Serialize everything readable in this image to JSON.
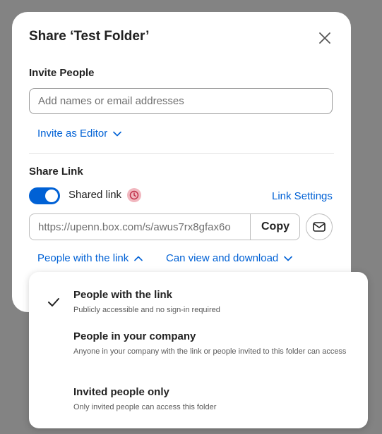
{
  "dialog": {
    "title": "Share ‘Test Folder’",
    "close_icon": "close-icon"
  },
  "invite": {
    "section_label": "Invite People",
    "placeholder": "Add names or email addresses",
    "value": "",
    "role_label": "Invite as Editor",
    "role_icon": "chevron-down-icon"
  },
  "share_link": {
    "section_label": "Share Link",
    "toggle_state": "on",
    "toggle_label": "Shared link",
    "badge_icon": "clock-icon",
    "settings_label": "Link Settings",
    "url": "https://upenn.box.com/s/awus7rx8gfax6o",
    "copy_label": "Copy",
    "email_icon": "envelope-icon",
    "access_label": "People with the link",
    "access_icon": "chevron-up-icon",
    "permission_label": "Can view and download",
    "permission_icon": "chevron-down-icon"
  },
  "access_menu": {
    "selected_index": 0,
    "options": [
      {
        "title": "People with the link",
        "description": "Publicly accessible and no sign-in required"
      },
      {
        "title": "People in your company",
        "description": "Anyone in your company with the link or people invited to this folder can access"
      },
      {
        "title": "Invited people only",
        "description": "Only invited people can access this folder"
      }
    ]
  },
  "colors": {
    "accent": "#0061d5",
    "overlay": "#838383",
    "badge": "#f1b7bf"
  }
}
